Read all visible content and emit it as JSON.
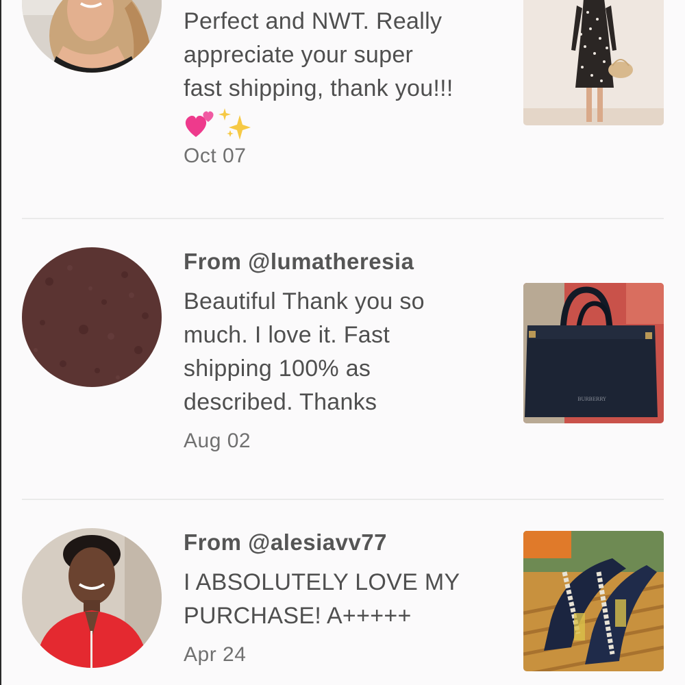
{
  "reviews": [
    {
      "from": "",
      "text_lines": [
        "Perfect and NWT. Really",
        "appreciate your super",
        "fast shipping, thank you!!!"
      ],
      "emojis": [
        "two-hearts",
        "sparkles"
      ],
      "date": "Oct 07",
      "product": "polka-dot-wrap-dress"
    },
    {
      "from": "From @lumatheresia",
      "text_lines": [
        "Beautiful  Thank you so",
        "much. I love it. Fast",
        "shipping 100% as",
        "described. Thanks"
      ],
      "date": "Aug 02",
      "product": "navy-leather-tote-bag"
    },
    {
      "from": "From @alesiavv77",
      "text_lines": [
        "I ABSOLUTELY LOVE MY",
        "PURCHASE! A+++++"
      ],
      "date": "Apr 24",
      "product": "embellished-t-strap-sandals"
    }
  ],
  "colors": {
    "background": "#fbfafb",
    "text": "#545454",
    "date": "#707070",
    "divider": "#eaeaea"
  }
}
